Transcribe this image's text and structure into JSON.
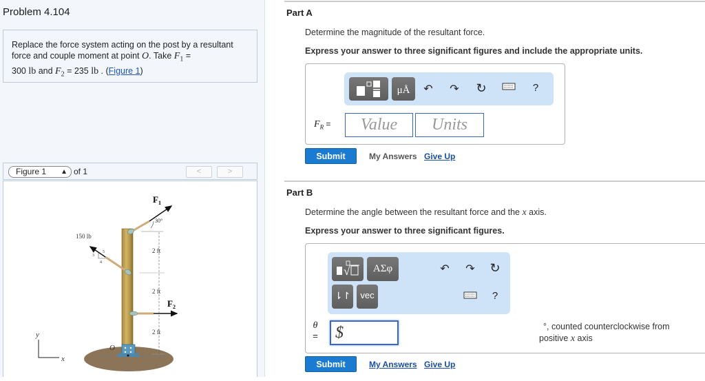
{
  "problem": {
    "title": "Problem 4.104",
    "text_part1": "Replace the force system acting on the post by a resultant force and couple moment at point ",
    "point": "O",
    "text_part2": ". Take ",
    "f1_sym": "F",
    "f1_sub": "1",
    "f1_eq": " = ",
    "f1_val": "300 ",
    "unit1": "lb",
    "and": " and ",
    "f2_sym": "F",
    "f2_sub": "2",
    "f2_eq": " = 235 ",
    "unit2": "lb",
    "period": " . (",
    "figure_link": "Figure 1",
    "close": ")"
  },
  "figure_nav": {
    "selected": "Figure 1",
    "of_label": "of 1",
    "prev": "<",
    "next": ">"
  },
  "figure": {
    "labels": {
      "F1": "F",
      "F1_sub": "1",
      "F2": "F",
      "F2_sub": "2",
      "angle": "30°",
      "force150": "150 lb",
      "slope_3": "3",
      "slope_4": "4",
      "slope_5": "5",
      "dim1": "2 ft",
      "dim2": "2 ft",
      "dim3": "2 ft",
      "point_O": "O",
      "axis_x": "x",
      "axis_y": "y"
    }
  },
  "partA": {
    "title": "Part A",
    "question": "Determine the magnitude of the resultant force.",
    "instruction": "Express your answer to three significant figures and include the appropriate units.",
    "toolbar": {
      "units_btn": "μÅ",
      "help": "?"
    },
    "label_sym": "F",
    "label_sub": "R",
    "label_eq": " =",
    "value_placeholder": "Value",
    "units_placeholder": "Units",
    "submit": "Submit",
    "my_answers": "My Answers",
    "give_up": "Give Up"
  },
  "partB": {
    "title": "Part B",
    "question_part1": "Determine the angle between the resultant force and the ",
    "question_x": "x",
    "question_part2": " axis.",
    "instruction": "Express your answer to three significant figures.",
    "toolbar": {
      "greek_btn": "ΑΣφ",
      "arrows_btn": "⇂↾",
      "vec_btn": "vec",
      "help": "?"
    },
    "label_sym": "θ",
    "label_eq": "=",
    "input_value": "$",
    "suffix_part1": "°, counted counterclockwise from",
    "suffix_part2": "positive ",
    "suffix_x": "x",
    "suffix_part3": " axis",
    "submit": "Submit",
    "my_answers": "My Answers",
    "give_up": "Give Up"
  }
}
